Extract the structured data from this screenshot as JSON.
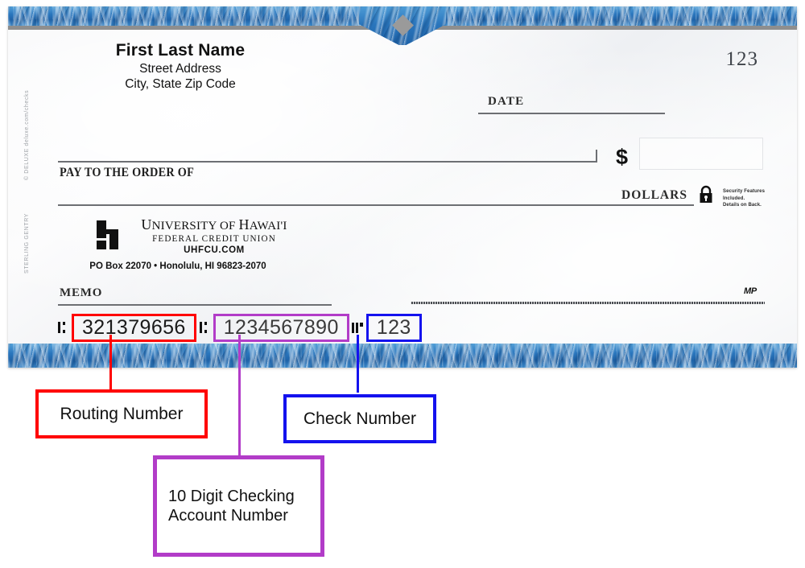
{
  "check": {
    "payer": {
      "name": "First Last Name",
      "street": "Street Address",
      "city_state_zip": "City, State Zip Code"
    },
    "check_number_top_right": "123",
    "deluxe_brand": "© DELUXE  deluxe.com/checks",
    "deluxe_pattern": "STERLING GENTRY",
    "date_label": "DATE",
    "pay_to_label": "PAY TO THE ORDER OF",
    "dollar_sign": "$",
    "dollars_label": "DOLLARS",
    "security_text_line1": "Security Features",
    "security_text_line2": "Included.",
    "security_text_line3": "Details on Back.",
    "memo_label": "MEMO",
    "microprint_mark": "MP",
    "bank": {
      "name_part1": "U",
      "name_part2": "NIVERSITY OF ",
      "name_part3": "H",
      "name_part4": "AWAI",
      "name_part5": "'",
      "name_part6": "I",
      "name_full": "UNIVERSITY OF HAWAI'I",
      "subtitle": "FEDERAL CREDIT UNION",
      "website": "UHFCU.COM",
      "address": "PO Box 22070 • Honolulu, HI 96823-2070"
    },
    "micr": {
      "routing_number": "321379656",
      "account_number": "1234567890",
      "check_number": "123"
    }
  },
  "annotations": {
    "routing_label": "Routing Number",
    "check_label": "Check Number",
    "account_label_line1": "10 Digit Checking",
    "account_label_line2": "Account Number"
  },
  "colors": {
    "routing_accent": "#ff0000",
    "account_accent": "#b23cc8",
    "check_accent": "#1412ee",
    "border_blue": "#2a76bd"
  }
}
